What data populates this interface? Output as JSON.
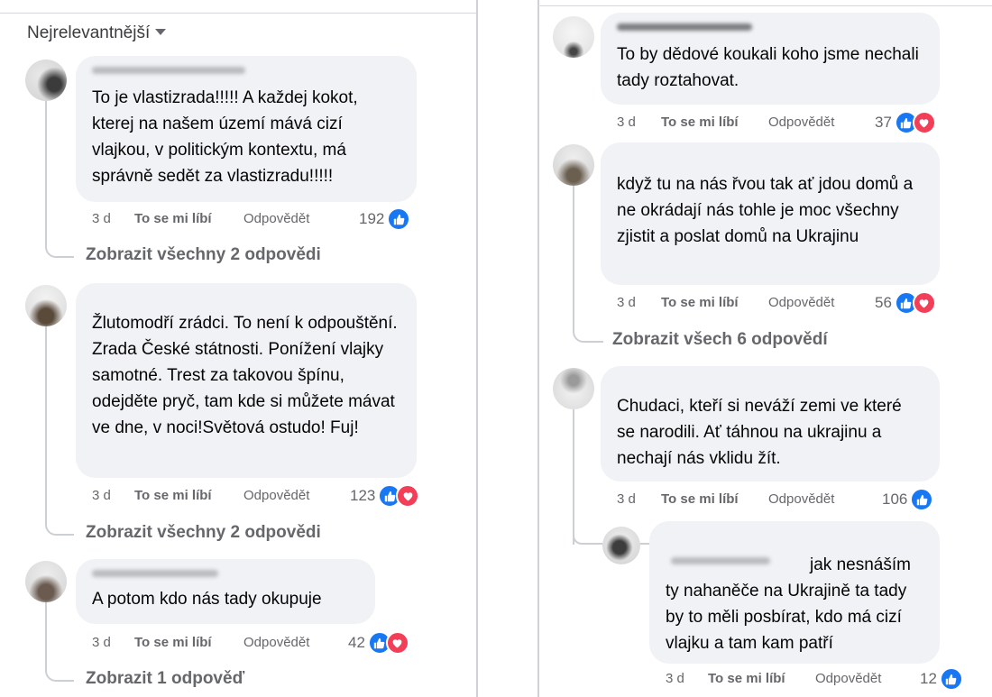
{
  "sort_label": "Nejrelevantnější",
  "left_comments": [
    {
      "text": "To je vlastizrada!!!!! A každej kokot, kterej na našem území mává cizí vlajkou, v politickým kontextu, má správně sedět za vlastizradu!!!!!",
      "time": "3 d",
      "like": "To se mi líbí",
      "reply": "Odpovědět",
      "count": "192",
      "reactions": [
        "like"
      ],
      "replies_link": "Zobrazit všechny 2 odpovědi"
    },
    {
      "text": "Žlutomodří zrádci. To není k odpouštění. Zrada České státnosti. Ponížení vlajky samotné. Trest za takovou špínu, odejděte pryč, tam kde si můžete mávat ve dne, v noci!Světová ostudo! Fuj!",
      "time": "3 d",
      "like": "To se mi líbí",
      "reply": "Odpovědět",
      "count": "123",
      "reactions": [
        "like",
        "love"
      ],
      "replies_link": "Zobrazit všechny 2 odpovědi"
    },
    {
      "text": "A potom kdo nás tady okupuje",
      "time": "3 d",
      "like": "To se mi líbí",
      "reply": "Odpovědět",
      "count": "42",
      "reactions": [
        "like",
        "love"
      ],
      "replies_link": "Zobrazit 1 odpověď"
    }
  ],
  "right_comments": [
    {
      "text": "To by dědové koukali koho jsme nechali tady roztahovat.",
      "time": "3 d",
      "like": "To se mi líbí",
      "reply": "Odpovědět",
      "count": "37",
      "reactions": [
        "like",
        "love"
      ]
    },
    {
      "text": "když tu na nás řvou tak ať jdou domů a ne okrádají nás tohle je moc všechny zjistit a poslat domů na Ukrajinu",
      "time": "3 d",
      "like": "To se mi líbí",
      "reply": "Odpovědět",
      "count": "56",
      "reactions": [
        "like",
        "love"
      ],
      "replies_link": "Zobrazit všech 6 odpovědí"
    },
    {
      "text": "Chudaci, kteří si neváží zemi ve které se narodili. Ať táhnou na ukrajinu a nechají nás vklidu žít.",
      "time": "3 d",
      "like": "To se mi líbí",
      "reply": "Odpovědět",
      "count": "106",
      "reactions": [
        "like"
      ]
    },
    {
      "text": "jak nesnáším ty nahaněče na Ukrajině ta tady by to měli posbírat, kdo má cizí vlajku a tam kam patří",
      "time": "3 d",
      "like": "To se mi líbí",
      "reply": "Odpovědět",
      "count": "12",
      "reactions": [
        "like"
      ]
    }
  ],
  "colors": {
    "like": "#1877f2",
    "love": "#f33e58",
    "bubble": "#f0f2f5",
    "meta": "#65676b"
  }
}
